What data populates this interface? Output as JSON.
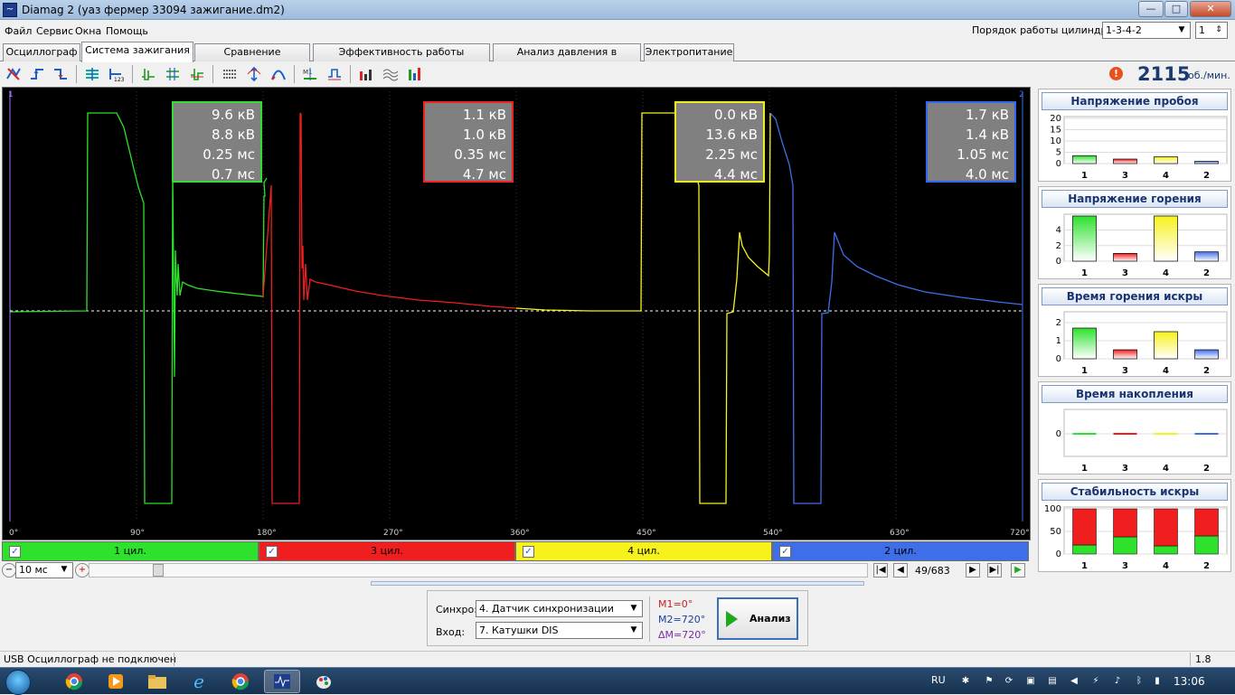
{
  "window": {
    "title": "Diamag 2 (уаз фермер 33094 зажигание.dm2)",
    "app_icon": "oscilloscope-icon"
  },
  "window_buttons": {
    "minimize": "—",
    "maximize": "□",
    "close": "✕"
  },
  "menu": [
    "Файл",
    "Сервис",
    "Окна",
    "Помощь"
  ],
  "cylinder_order": {
    "label": "Порядок работы цилиндров",
    "value": "1-3-4-2",
    "number": "1"
  },
  "tabs": [
    {
      "label": "Осциллограф",
      "active": false
    },
    {
      "label": "Система зажигания",
      "active": true
    },
    {
      "label": "Сравнение цилиндров",
      "active": false
    },
    {
      "label": "Эффективность работы цилиндров",
      "active": false
    },
    {
      "label": "Анализ давления в цилиндре",
      "active": false
    },
    {
      "label": "Электропитание",
      "active": false
    }
  ],
  "rpm": {
    "value": "2115",
    "unit": "об./мин.",
    "warning": "!"
  },
  "scope": {
    "marker_left": "1",
    "marker_right": "2",
    "x_ticks": [
      "0°",
      "90°",
      "180°",
      "270°",
      "360°",
      "450°",
      "540°",
      "630°",
      "720°"
    ],
    "measurements": [
      {
        "lines": [
          "9.6 кВ",
          "8.8 кВ",
          "0.25 мс",
          "0.7 мс"
        ],
        "border": "#33dd33"
      },
      {
        "lines": [
          "1.1 кВ",
          "1.0 кВ",
          "0.35 мс",
          "4.7 мс"
        ],
        "border": "#ee2222"
      },
      {
        "lines": [
          "0.0 кВ",
          "13.6 кВ",
          "2.25 мс",
          "4.4 мс"
        ],
        "border": "#eeee22"
      },
      {
        "lines": [
          "1.7 кВ",
          "1.4 кВ",
          "1.05 мс",
          "4.0 мс"
        ],
        "border": "#3366ee"
      }
    ]
  },
  "cylinders": [
    {
      "label": "1 цил.",
      "color": "#2de12d",
      "checked": "✓"
    },
    {
      "label": "3 цил.",
      "color": "#f01e1e",
      "checked": "✓"
    },
    {
      "label": "4 цил.",
      "color": "#f7f21c",
      "checked": "✓"
    },
    {
      "label": "2 цил.",
      "color": "#3f6fe8",
      "checked": "✓"
    }
  ],
  "timebase": {
    "value": "10 мс"
  },
  "navigation": {
    "page": "49/683"
  },
  "control": {
    "sync_label": "Синхро:",
    "sync_value": "4.  Датчик синхронизации",
    "input_label": "Вход:",
    "input_value": "7.  Катушки DIS",
    "m1": "M1=0°",
    "m2": "M2=720°",
    "dm": "ΔM=720°",
    "analyze": "Анализ"
  },
  "status": {
    "text": "USB Осциллограф не подключен",
    "version": "1.8"
  },
  "panels": [
    {
      "title": "Напряжение пробоя",
      "yticks": [
        "20",
        "15",
        "10",
        "5",
        "0"
      ]
    },
    {
      "title": "Напряжение горения",
      "yticks": [
        "4",
        "2",
        "0"
      ]
    },
    {
      "title": "Время горения искры",
      "yticks": [
        "2",
        "1",
        "0"
      ]
    },
    {
      "title": "Время накопления",
      "yticks": [
        "0"
      ]
    },
    {
      "title": "Стабильность искры",
      "yticks": [
        "100",
        "50",
        "0"
      ]
    }
  ],
  "panel_categories": [
    "1",
    "3",
    "4",
    "2"
  ],
  "chart_data": [
    {
      "type": "bar",
      "title": "Напряжение пробоя",
      "categories": [
        "1",
        "3",
        "4",
        "2"
      ],
      "values": [
        3.5,
        2.0,
        3.0,
        1.0
      ],
      "ylim": [
        0,
        20
      ],
      "colors": [
        "#2de12d",
        "#f01e1e",
        "#f7f21c",
        "#3f6fe8"
      ]
    },
    {
      "type": "bar",
      "title": "Напряжение горения",
      "categories": [
        "1",
        "3",
        "4",
        "2"
      ],
      "values": [
        5.8,
        1.0,
        5.8,
        1.2
      ],
      "ylim": [
        0,
        5.8
      ],
      "colors": [
        "#2de12d",
        "#f01e1e",
        "#f7f21c",
        "#3f6fe8"
      ]
    },
    {
      "type": "bar",
      "title": "Время горения искры",
      "categories": [
        "1",
        "3",
        "4",
        "2"
      ],
      "values": [
        1.7,
        0.5,
        1.5,
        0.5
      ],
      "ylim": [
        0,
        2.5
      ],
      "colors": [
        "#2de12d",
        "#f01e1e",
        "#f7f21c",
        "#3f6fe8"
      ]
    },
    {
      "type": "bar",
      "title": "Время накопления",
      "categories": [
        "1",
        "3",
        "4",
        "2"
      ],
      "values": [
        0,
        0,
        0,
        0
      ],
      "ylim": [
        -1,
        1
      ],
      "colors": [
        "#2de12d",
        "#f01e1e",
        "#f7f21c",
        "#3f6fe8"
      ]
    },
    {
      "type": "bar",
      "title": "Стабильность искры",
      "categories": [
        "1",
        "3",
        "4",
        "2"
      ],
      "series": [
        {
          "values": [
            20,
            38,
            18,
            40
          ],
          "color": "#2de12d"
        },
        {
          "values": [
            80,
            62,
            82,
            60
          ],
          "color": "#f01e1e"
        }
      ],
      "ylim": [
        0,
        100
      ],
      "stacked": true
    }
  ],
  "taskbar": {
    "lang": "RU",
    "clock": "13:06",
    "apps": [
      "chrome-icon",
      "media-player-icon",
      "folder-icon",
      "ie-icon",
      "chrome-icon",
      "diamag-icon",
      "paint-icon"
    ]
  }
}
